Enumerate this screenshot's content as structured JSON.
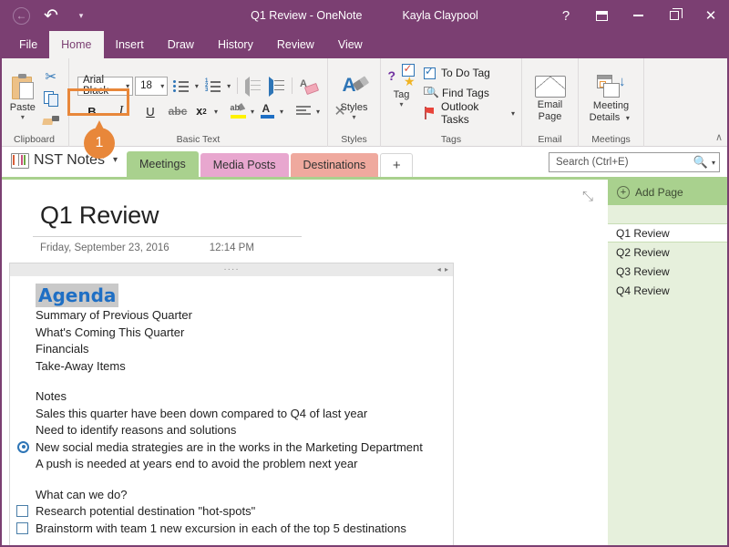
{
  "titlebar": {
    "window_title": "Q1 Review - OneNote",
    "user": "Kayla Claypool",
    "quick_access": {
      "back": "←",
      "undo": "↶",
      "customize": "▾"
    },
    "help": "?",
    "bg_color": "#7B3F72"
  },
  "ribbon_tabs": [
    {
      "label": "File"
    },
    {
      "label": "Home"
    },
    {
      "label": "Insert"
    },
    {
      "label": "Draw"
    },
    {
      "label": "History"
    },
    {
      "label": "Review"
    },
    {
      "label": "View"
    }
  ],
  "ribbon": {
    "clipboard": {
      "paste": "Paste",
      "caret": "▾",
      "group_label": "Clipboard"
    },
    "basic_text": {
      "font_name": "Arial Black",
      "font_size": "18",
      "caret": "▾",
      "bold": "B",
      "italic": "I",
      "underline": "U",
      "strikethrough": "abc",
      "subscript": "x",
      "subscript_sub": "2",
      "clear_formatting": "✕",
      "group_label": "Basic Text"
    },
    "styles": {
      "label": "Styles",
      "caret": "▾",
      "group_label": "Styles"
    },
    "tags": {
      "tag_label": "Tag",
      "caret": "▾",
      "items": [
        {
          "label": "To Do Tag"
        },
        {
          "label": "Find Tags"
        },
        {
          "label": "Outlook Tasks",
          "caret": "▾"
        }
      ],
      "group_label": "Tags"
    },
    "email": {
      "line1": "Email",
      "line2": "Page",
      "group_label": "Email"
    },
    "meetings": {
      "line1": "Meeting",
      "line2": "Details",
      "caret": "▾",
      "group_label": "Meetings"
    },
    "collapse": "∧"
  },
  "callout": {
    "number": "1",
    "accent_color": "#E8873A"
  },
  "navbar": {
    "notebook": "NST Notes",
    "notebook_caret": "▾",
    "sections": [
      {
        "label": "Meetings",
        "color": "#A9D18E",
        "active": true
      },
      {
        "label": "Media Posts",
        "color": "#E8A7CF",
        "active": false
      },
      {
        "label": "Destinations",
        "color": "#EFA99E",
        "active": false
      }
    ],
    "add_section": "+",
    "search": {
      "placeholder": "Search (Ctrl+E)",
      "icon": "⌕",
      "caret": "▾"
    }
  },
  "page": {
    "title": "Q1 Review",
    "date": "Friday, September 23, 2016",
    "time": "12:14 PM",
    "expand_icon": "⤡",
    "note_handle_dots": "····",
    "note_handle_arrows": "◂ ▸",
    "heading": "Agenda",
    "agenda_items": [
      "Summary of Previous Quarter",
      "What's Coming This Quarter",
      "Financials",
      "Take-Away Items"
    ],
    "notes_heading": "Notes",
    "notes_lines": [
      {
        "text": "Sales this quarter have been down compared to Q4 of last year",
        "marker": "none"
      },
      {
        "text": "Need to identify reasons and solutions",
        "marker": "none"
      },
      {
        "text": "New social media strategies are in the works in the Marketing Department",
        "marker": "target"
      },
      {
        "text": "A push is needed at years end to avoid the problem next year",
        "marker": "none"
      }
    ],
    "question": "What can we do?",
    "todo_items": [
      {
        "text": "Research potential destination \"hot-spots\"",
        "checked": false
      },
      {
        "text": "Brainstorm with team 1 new excursion in each of the top 5 destinations",
        "checked": false
      }
    ]
  },
  "pagelist": {
    "add_page": "Add Page",
    "add_icon": "+",
    "pages": [
      {
        "label": "Q1 Review",
        "active": true
      },
      {
        "label": "Q2 Review",
        "active": false
      },
      {
        "label": "Q3 Review",
        "active": false
      },
      {
        "label": "Q4 Review",
        "active": false
      }
    ],
    "bg_color": "#E6F0DC"
  }
}
